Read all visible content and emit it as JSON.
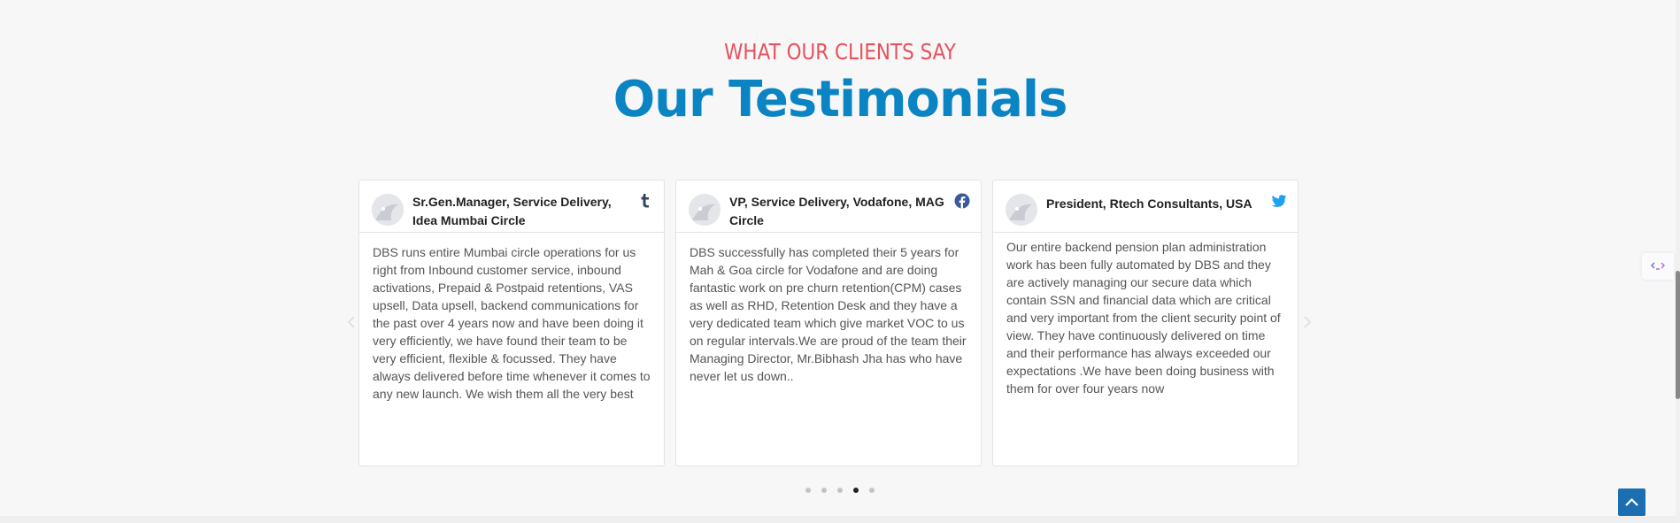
{
  "section": {
    "eyebrow": "WHAT OUR CLIENTS SAY",
    "title": "Our Testimonials"
  },
  "testimonials": [
    {
      "author": "Sr.Gen.Manager, Service Delivery, Idea Mumbai Circle",
      "social_icon": "tumblr-icon",
      "text": "DBS runs entire Mumbai circle operations for us right from Inbound customer service, inbound activations, Prepaid & Postpaid retentions, VAS upsell, Data upsell, backend communications for the past over 4 years now and have been doing it very efficiently, we have found their team to be very efficient, flexible & focussed. They have always delivered before time whenever it comes to any new launch. We wish them all the very best"
    },
    {
      "author": "VP, Service Delivery, Vodafone, MAG Circle",
      "social_icon": "facebook-icon",
      "text": "DBS successfully has completed their 5 years for Mah & Goa circle for Vodafone and are doing fantastic work on pre churn retention(CPM) cases as well as RHD, Retention Desk and they have a very dedicated team which give market VOC to us on regular intervals.We are proud of the team their Managing Director, Mr.Bibhash Jha has who have never let us down.."
    },
    {
      "author": "President, Rtech Consultants, USA",
      "social_icon": "twitter-icon",
      "text": "Our entire backend pension plan administration work has been fully automated by DBS and they are actively managing our secure data which contain SSN and financial data which are critical and very important from the client security point of view. They have continuously delivered on time and their performance has always exceeded our expectations .We have been doing business with them for over four years now"
    }
  ],
  "carousel": {
    "total_pages": 5,
    "active_page": 4
  },
  "colors": {
    "eyebrow": "#e5525d",
    "title": "#0a84c2",
    "tumblr": "#35465c",
    "facebook": "#3b5998",
    "twitter": "#1da1f2",
    "back_to_top": "#1b6fb0"
  }
}
